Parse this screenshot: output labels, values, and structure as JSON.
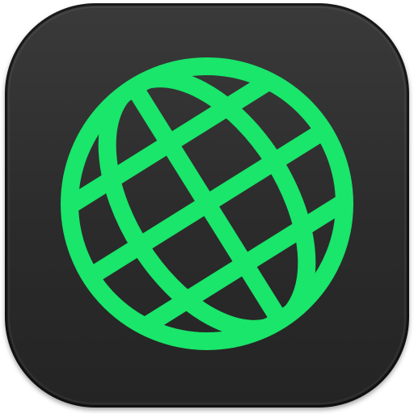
{
  "app_icon": {
    "icon": "globe-icon",
    "background_color": "#2b2b2b",
    "glyph_color": "#19e66a"
  }
}
